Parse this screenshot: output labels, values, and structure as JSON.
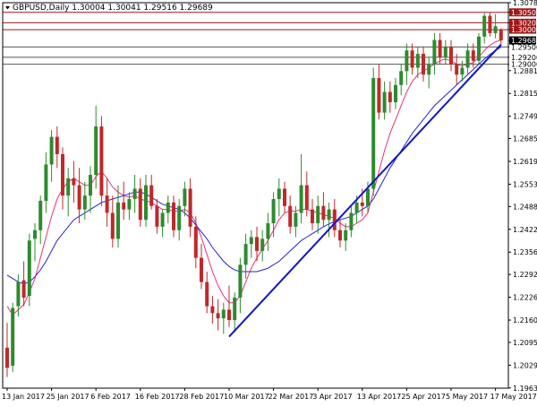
{
  "chart_data": {
    "type": "candlestick",
    "title": "GBPUSD,Daily  1.30004 1.30041 1.29516 1.29689",
    "colors": {
      "bull": "#2e8b2e",
      "bear": "#c0282a",
      "fast_ma": "#e8337a",
      "slow_ma": "#2323d8",
      "trendline": "#1414c8",
      "resistance": "#a01818",
      "support": "#555555",
      "current_price_bg": "#000000",
      "current_price_text": "#ffffff"
    },
    "ylim": [
      1.1963,
      1.3078
    ],
    "y_ticks": [
      "1.30780",
      "1.30500",
      "1.30200",
      "1.30000",
      "1.29689",
      "1.29500",
      "1.29200",
      "1.29000",
      "1.28815",
      "1.28155",
      "1.27495",
      "1.26850",
      "1.26190",
      "1.25530",
      "1.24885",
      "1.24225",
      "1.23565",
      "1.22920",
      "1.22260",
      "1.21600",
      "1.20955",
      "1.20295",
      "1.19635"
    ],
    "x_ticks": [
      {
        "label": "13 Jan 2017",
        "index": 0
      },
      {
        "label": "25 Jan 2017",
        "index": 8
      },
      {
        "label": "6 Feb 2017",
        "index": 16
      },
      {
        "label": "16 Feb 2017",
        "index": 24
      },
      {
        "label": "28 Feb 2017",
        "index": 32
      },
      {
        "label": "10 Mar 2017",
        "index": 40
      },
      {
        "label": "22 Mar 2017",
        "index": 48
      },
      {
        "label": "3 Apr 2017",
        "index": 56
      },
      {
        "label": "13 Apr 2017",
        "index": 64
      },
      {
        "label": "25 Apr 2017",
        "index": 72
      },
      {
        "label": "5 May 2017",
        "index": 80
      },
      {
        "label": "17 May 2017",
        "index": 88
      }
    ],
    "levels": [
      {
        "price": 1.305,
        "label": "1.30500",
        "kind": "resistance"
      },
      {
        "price": 1.302,
        "label": "1.30200",
        "kind": "resistance"
      },
      {
        "price": 1.3,
        "label": "1.30000",
        "kind": "resistance"
      },
      {
        "price": 1.295,
        "label": "1.29500",
        "kind": "support"
      },
      {
        "price": 1.292,
        "label": "1.29200",
        "kind": "support"
      },
      {
        "price": 1.29,
        "label": "1.29000",
        "kind": "support"
      }
    ],
    "current_price": {
      "price": 1.29689,
      "label": "1.29689"
    },
    "trendline": {
      "from": {
        "index": 40,
        "price": 1.2112
      },
      "to": {
        "index": 89,
        "price": 1.2957
      }
    },
    "candles": [
      [
        1.208,
        1.2152,
        1.1995,
        1.2022
      ],
      [
        1.2028,
        1.221,
        1.201,
        1.2195
      ],
      [
        1.22,
        1.2292,
        1.217,
        1.227
      ],
      [
        1.2275,
        1.233,
        1.22,
        1.2225
      ],
      [
        1.223,
        1.241,
        1.22,
        1.239
      ],
      [
        1.2395,
        1.244,
        1.233,
        1.242
      ],
      [
        1.242,
        1.252,
        1.238,
        1.2505
      ],
      [
        1.2505,
        1.2645,
        1.247,
        1.261
      ],
      [
        1.261,
        1.271,
        1.256,
        1.269
      ],
      [
        1.269,
        1.272,
        1.26,
        1.264
      ],
      [
        1.264,
        1.266,
        1.248,
        1.252
      ],
      [
        1.252,
        1.26,
        1.246,
        1.257
      ],
      [
        1.257,
        1.262,
        1.25,
        1.255
      ],
      [
        1.255,
        1.26,
        1.244,
        1.248
      ],
      [
        1.248,
        1.256,
        1.245,
        1.252
      ],
      [
        1.252,
        1.2605,
        1.247,
        1.258
      ],
      [
        1.258,
        1.278,
        1.254,
        1.272
      ],
      [
        1.272,
        1.275,
        1.249,
        1.252
      ],
      [
        1.252,
        1.257,
        1.243,
        1.247
      ],
      [
        1.247,
        1.252,
        1.237,
        1.2395
      ],
      [
        1.2395,
        1.255,
        1.237,
        1.25
      ],
      [
        1.25,
        1.256,
        1.245,
        1.248
      ],
      [
        1.248,
        1.253,
        1.245,
        1.251
      ],
      [
        1.251,
        1.258,
        1.247,
        1.254
      ],
      [
        1.254,
        1.257,
        1.243,
        1.245
      ],
      [
        1.245,
        1.258,
        1.243,
        1.255
      ],
      [
        1.255,
        1.258,
        1.248,
        1.249
      ],
      [
        1.249,
        1.251,
        1.241,
        1.243
      ],
      [
        1.243,
        1.248,
        1.24,
        1.247
      ],
      [
        1.247,
        1.252,
        1.244,
        1.25
      ],
      [
        1.25,
        1.252,
        1.24,
        1.242
      ],
      [
        1.242,
        1.251,
        1.239,
        1.249
      ],
      [
        1.249,
        1.256,
        1.246,
        1.254
      ],
      [
        1.254,
        1.257,
        1.24,
        1.243
      ],
      [
        1.243,
        1.246,
        1.231,
        1.234
      ],
      [
        1.234,
        1.238,
        1.225,
        1.227
      ],
      [
        1.227,
        1.23,
        1.218,
        1.22
      ],
      [
        1.22,
        1.223,
        1.215,
        1.218
      ],
      [
        1.218,
        1.222,
        1.213,
        1.2165
      ],
      [
        1.2165,
        1.221,
        1.212,
        1.219
      ],
      [
        1.219,
        1.226,
        1.214,
        1.216
      ],
      [
        1.216,
        1.224,
        1.2125,
        1.2225
      ],
      [
        1.2225,
        1.234,
        1.218,
        1.232
      ],
      [
        1.232,
        1.241,
        1.228,
        1.238
      ],
      [
        1.238,
        1.242,
        1.234,
        1.24
      ],
      [
        1.24,
        1.243,
        1.233,
        1.236
      ],
      [
        1.236,
        1.242,
        1.233,
        1.2395
      ],
      [
        1.2395,
        1.247,
        1.236,
        1.244
      ],
      [
        1.244,
        1.253,
        1.24,
        1.251
      ],
      [
        1.251,
        1.257,
        1.246,
        1.254
      ],
      [
        1.254,
        1.256,
        1.247,
        1.249
      ],
      [
        1.249,
        1.252,
        1.241,
        1.243
      ],
      [
        1.243,
        1.249,
        1.24,
        1.247
      ],
      [
        1.247,
        1.264,
        1.244,
        1.255
      ],
      [
        1.255,
        1.259,
        1.246,
        1.248
      ],
      [
        1.248,
        1.251,
        1.242,
        1.244
      ],
      [
        1.244,
        1.252,
        1.241,
        1.249
      ],
      [
        1.249,
        1.253,
        1.243,
        1.245
      ],
      [
        1.245,
        1.25,
        1.24,
        1.248
      ],
      [
        1.248,
        1.251,
        1.24,
        1.242
      ],
      [
        1.242,
        1.245,
        1.237,
        1.239
      ],
      [
        1.239,
        1.244,
        1.236,
        1.242
      ],
      [
        1.242,
        1.249,
        1.24,
        1.247
      ],
      [
        1.247,
        1.252,
        1.244,
        1.25
      ],
      [
        1.25,
        1.254,
        1.246,
        1.249
      ],
      [
        1.249,
        1.256,
        1.247,
        1.254
      ],
      [
        1.254,
        1.289,
        1.252,
        1.286
      ],
      [
        1.286,
        1.29,
        1.274,
        1.276
      ],
      [
        1.276,
        1.285,
        1.274,
        1.282
      ],
      [
        1.282,
        1.285,
        1.276,
        1.279
      ],
      [
        1.279,
        1.286,
        1.277,
        1.284
      ],
      [
        1.284,
        1.29,
        1.281,
        1.288
      ],
      [
        1.288,
        1.296,
        1.284,
        1.294
      ],
      [
        1.294,
        1.296,
        1.287,
        1.289
      ],
      [
        1.289,
        1.295,
        1.286,
        1.293
      ],
      [
        1.293,
        1.295,
        1.285,
        1.287
      ],
      [
        1.287,
        1.292,
        1.283,
        1.29
      ],
      [
        1.29,
        1.299,
        1.287,
        1.297
      ],
      [
        1.297,
        1.299,
        1.29,
        1.292
      ],
      [
        1.292,
        1.297,
        1.29,
        1.295
      ],
      [
        1.295,
        1.297,
        1.288,
        1.29
      ],
      [
        1.29,
        1.293,
        1.284,
        1.287
      ],
      [
        1.287,
        1.291,
        1.285,
        1.289
      ],
      [
        1.289,
        1.296,
        1.287,
        1.294
      ],
      [
        1.294,
        1.296,
        1.289,
        1.291
      ],
      [
        1.291,
        1.299,
        1.29,
        1.298
      ],
      [
        1.298,
        1.3048,
        1.296,
        1.304
      ],
      [
        1.304,
        1.305,
        1.298,
        1.299
      ],
      [
        1.299,
        1.3045,
        1.2975,
        1.301
      ],
      [
        1.30004,
        1.30041,
        1.29516,
        1.29689
      ]
    ],
    "fast_ma": [
      1.22,
      1.2175,
      1.219,
      1.2205,
      1.224,
      1.228,
      1.234,
      1.24,
      1.246,
      1.251,
      1.254,
      1.256,
      1.257,
      1.256,
      1.255,
      1.255,
      1.2575,
      1.259,
      1.257,
      1.2545,
      1.253,
      1.252,
      1.2515,
      1.252,
      1.251,
      1.2505,
      1.25,
      1.249,
      1.248,
      1.248,
      1.2475,
      1.2475,
      1.248,
      1.247,
      1.244,
      1.24,
      1.235,
      1.23,
      1.226,
      1.223,
      1.221,
      1.221,
      1.223,
      1.227,
      1.231,
      1.234,
      1.2365,
      1.239,
      1.242,
      1.245,
      1.247,
      1.2475,
      1.2475,
      1.248,
      1.248,
      1.2475,
      1.247,
      1.2465,
      1.246,
      1.2455,
      1.244,
      1.243,
      1.243,
      1.244,
      1.245,
      1.247,
      1.253,
      1.259,
      1.265,
      1.27,
      1.274,
      1.278,
      1.282,
      1.285,
      1.287,
      1.288,
      1.289,
      1.29,
      1.291,
      1.2915,
      1.291,
      1.29,
      1.2895,
      1.29,
      1.2905,
      1.292,
      1.294,
      1.2955,
      1.2965,
      1.297
    ],
    "slow_ma": [
      1.229,
      1.228,
      1.227,
      1.2265,
      1.227,
      1.2285,
      1.2305,
      1.233,
      1.236,
      1.239,
      1.241,
      1.243,
      1.245,
      1.246,
      1.247,
      1.248,
      1.249,
      1.25,
      1.2505,
      1.251,
      1.2515,
      1.252,
      1.2525,
      1.253,
      1.253,
      1.2525,
      1.2515,
      1.2505,
      1.2495,
      1.249,
      1.2485,
      1.248,
      1.247,
      1.2455,
      1.2435,
      1.2415,
      1.2395,
      1.237,
      1.235,
      1.233,
      1.2315,
      1.2305,
      1.23,
      1.23,
      1.23,
      1.23,
      1.2305,
      1.231,
      1.232,
      1.233,
      1.2345,
      1.236,
      1.2375,
      1.239,
      1.24,
      1.241,
      1.242,
      1.243,
      1.2438,
      1.2445,
      1.245,
      1.2455,
      1.246,
      1.247,
      1.248,
      1.249,
      1.251,
      1.254,
      1.257,
      1.26,
      1.2625,
      1.265,
      1.2675,
      1.27,
      1.272,
      1.274,
      1.276,
      1.278,
      1.2795,
      1.281,
      1.2825,
      1.284,
      1.2855,
      1.287,
      1.2885,
      1.29,
      1.2915,
      1.2928,
      1.294,
      1.295
    ]
  }
}
